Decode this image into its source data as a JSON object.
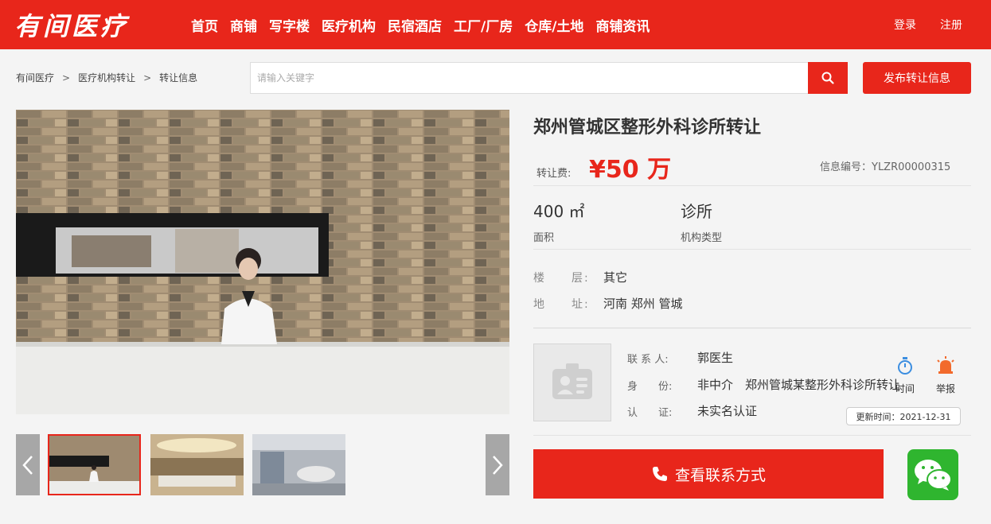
{
  "header": {
    "logo": "有间医疗",
    "nav": [
      "首页",
      "商铺",
      "写字楼",
      "医疗机构",
      "民宿酒店",
      "工厂/厂房",
      "仓库/土地",
      "商铺资讯"
    ],
    "login": "登录",
    "register": "注册"
  },
  "breadcrumb": [
    "有间医疗",
    "医疗机构转让",
    "转让信息"
  ],
  "breadcrumb_sep": ">",
  "search": {
    "placeholder": "请输入关键字"
  },
  "publish_label": "发布转让信息",
  "listing": {
    "title": "郑州管城区整形外科诊所转让",
    "price_label": "转让费:",
    "price": "¥50 万",
    "info_no": "信息编号：YLZR00000315",
    "area_value": "400 ㎡",
    "area_label": "面积",
    "type_value": "诊所",
    "type_label": "机构类型",
    "floor_key": "楼　　层:",
    "floor_val": "其它",
    "address_key": "地　　址:",
    "address_val": "河南 郑州 管城"
  },
  "contact": {
    "person_key": "联 系 人:",
    "person_val": "郭医生",
    "identity_key": "身　　份:",
    "identity_val": "非中介　郑州管城某整形外科诊所转让",
    "auth_key": "认　　证:",
    "auth_val": "未实名认证",
    "time_label": "时间",
    "report_label": "举报",
    "update_tip": "更新时间：2021-12-31",
    "call_label": "查看联系方式"
  },
  "colors": {
    "brand": "#e8261b",
    "wechat": "#2fb52f"
  }
}
